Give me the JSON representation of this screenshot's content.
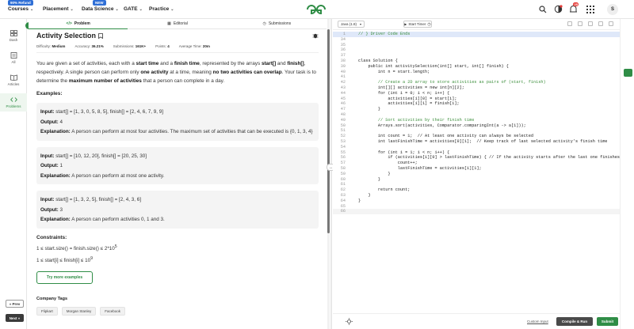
{
  "header": {
    "promo_badge": "90% Refund",
    "new_badge": "NEW",
    "nav": [
      {
        "label": "Courses"
      },
      {
        "label": "Placement"
      },
      {
        "label": "Data Science"
      },
      {
        "label": "GATE"
      },
      {
        "label": "Practice"
      }
    ],
    "notification_count": "25",
    "avatar_initial": "S",
    "brand_color": "#2f8d46"
  },
  "sidebar": {
    "items": [
      {
        "label": "Dash",
        "icon": "dashboard-icon"
      },
      {
        "label": "All",
        "icon": "all-icon"
      },
      {
        "label": "Articles",
        "icon": "article-icon"
      },
      {
        "label": "Problems",
        "icon": "code-icon"
      }
    ],
    "prev_label": "« Prev",
    "next_label": "Next »"
  },
  "tabs": [
    {
      "label": "Problem",
      "icon": "code-icon"
    },
    {
      "label": "Editorial",
      "icon": "book-icon"
    },
    {
      "label": "Submissions",
      "icon": "clock-icon"
    }
  ],
  "problem": {
    "title": "Activity Selection",
    "difficulty_label": "Difficulty:",
    "difficulty": "Medium",
    "accuracy_label": "Accuracy:",
    "accuracy": "36.21%",
    "submissions_label": "Submissions:",
    "submissions": "161K+",
    "points_label": "Points:",
    "points": "4",
    "avg_time_label": "Average Time:",
    "avg_time": "20m",
    "desc": {
      "p1": "You are given a set of activities, each with a ",
      "b1": "start time",
      "p2": " and a ",
      "b2": "finish time",
      "p3": ", represented by the arrays ",
      "b3": "start[]",
      "p4": " and ",
      "b4": "finish[]",
      "p5": ", respectively. A single person can perform only ",
      "b5": "one activity",
      "p6": " at a time, meaning ",
      "b6": "no two activities can overlap",
      "p7": ". Your task is to determine the ",
      "b7": "maximum number of activities",
      "p8": " that a person can complete in a day."
    },
    "examples_heading": "Examples:",
    "input_label": "Input:",
    "output_label": "Output:",
    "explanation_label": "Explanation:",
    "examples": [
      {
        "input": " start[] = [1, 3, 0, 5, 8, 5], finish[] = [2, 4, 6, 7, 9, 9]",
        "output": " 4",
        "explanation": " A person can perform at most four activities. The maximum set of activities that can be executed is {0, 1, 3, 4}"
      },
      {
        "input": " start[] = [10, 12, 20], finish[] = [20, 25, 30]",
        "output": " 1",
        "explanation": " A person can perform at most one activity."
      },
      {
        "input": " start[] = [1, 3, 2, 5], finish[] = [2, 4, 3, 6]",
        "output": " 3",
        "explanation": " A person can perform activities 0, 1 and 3."
      }
    ],
    "constraints_heading": "Constraints:",
    "constraint1": "1 ≤ start.size() = finish.size() ≤ 2*10",
    "constraint1_exp": "5",
    "constraint2": "1 ≤ start[i] ≤ finish[i] ≤ 10",
    "constraint2_exp": "9",
    "more_examples": "Try more examples",
    "company_tags_heading": "Company Tags",
    "company_tags": [
      "Flipkart",
      "Morgan Stanley",
      "Facebook"
    ]
  },
  "editor": {
    "language": "Java (1.8)",
    "timer_label": "Start Timer",
    "custom_input": "Custom Input",
    "compile_run": "Compile & Run",
    "submit": "Submit",
    "lines": [
      {
        "n": "1",
        "t": "// } Driver Code Ends",
        "hl": true
      },
      {
        "n": "34",
        "t": ""
      },
      {
        "n": "35",
        "t": ""
      },
      {
        "n": "36",
        "t": ""
      },
      {
        "n": "37",
        "t": ""
      },
      {
        "n": "38",
        "t": "class Solution {"
      },
      {
        "n": "39",
        "t": "    public int activitySelection(int[] start, int[] finish) {"
      },
      {
        "n": "40",
        "t": "        int n = start.length;"
      },
      {
        "n": "41",
        "t": ""
      },
      {
        "n": "42",
        "t": "        // Create a 2D array to store activities as pairs of (start, finish)"
      },
      {
        "n": "43",
        "t": "        int[][] activities = new int[n][2];"
      },
      {
        "n": "44",
        "t": "        for (int i = 0; i < n; i++) {"
      },
      {
        "n": "45",
        "t": "            activities[i][0] = start[i];"
      },
      {
        "n": "46",
        "t": "            activities[i][1] = finish[i];"
      },
      {
        "n": "47",
        "t": "        }"
      },
      {
        "n": "48",
        "t": ""
      },
      {
        "n": "49",
        "t": "        // Sort activities by their finish time"
      },
      {
        "n": "50",
        "t": "        Arrays.sort(activities, Comparator.comparingInt(a -> a[1]));"
      },
      {
        "n": "51",
        "t": ""
      },
      {
        "n": "52",
        "t": "        int count = 1;  // At least one activity can always be selected"
      },
      {
        "n": "53",
        "t": "        int lastFinishTime = activities[0][1];  // Keep track of last selected activity's finish time"
      },
      {
        "n": "54",
        "t": ""
      },
      {
        "n": "55",
        "t": "        for (int i = 1; i < n; i++) {"
      },
      {
        "n": "56",
        "t": "            if (activities[i][0] > lastFinishTime) { // If the activity starts after the last one finishes"
      },
      {
        "n": "57",
        "t": "                count++;"
      },
      {
        "n": "58",
        "t": "                lastFinishTime = activities[i][1];"
      },
      {
        "n": "59",
        "t": "            }"
      },
      {
        "n": "60",
        "t": "        }"
      },
      {
        "n": "61",
        "t": ""
      },
      {
        "n": "62",
        "t": "        return count;"
      },
      {
        "n": "63",
        "t": "    }"
      },
      {
        "n": "64",
        "t": "}"
      },
      {
        "n": "65",
        "t": ""
      },
      {
        "n": "66",
        "t": "",
        "cur": true
      }
    ]
  }
}
